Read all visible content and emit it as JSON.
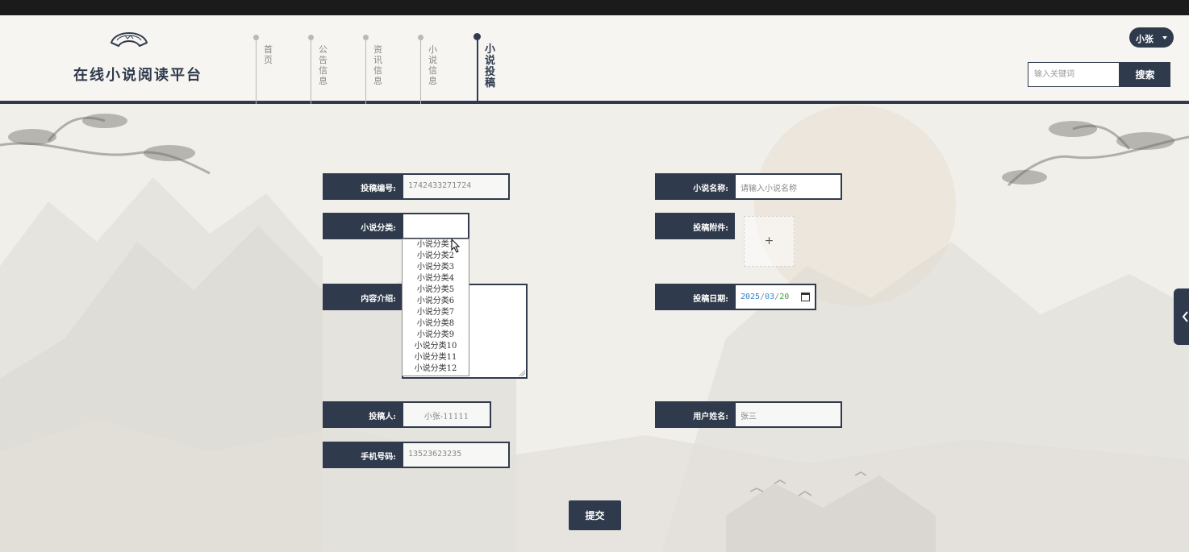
{
  "header": {
    "logo_text": "在线小说阅读平台",
    "nav": [
      {
        "label": "首页",
        "active": false
      },
      {
        "label": "公告信息",
        "active": false
      },
      {
        "label": "资讯信息",
        "active": false
      },
      {
        "label": "小说信息",
        "active": false
      },
      {
        "label": "小说投稿",
        "active": true
      }
    ],
    "user_label": "小张",
    "search_placeholder": "输入关键词",
    "search_button": "搜索"
  },
  "form": {
    "submission_no_label": "投稿编号:",
    "submission_no_value": "1742433271724",
    "novel_name_label": "小说名称:",
    "novel_name_placeholder": "请输入小说名称",
    "category_label": "小说分类:",
    "category_value": "",
    "attachment_label": "投稿附件:",
    "attachment_plus": "+",
    "intro_label": "内容介绍:",
    "date_label": "投稿日期:",
    "date_year": "2025",
    "date_sep": "/",
    "date_month": "03",
    "date_day": "20",
    "submitter_label": "投稿人:",
    "submitter_value": "小张-11111",
    "username_label": "用户姓名:",
    "username_value": "张三",
    "phone_label": "手机号码:",
    "phone_value": "13523623235",
    "submit_button": "提交"
  },
  "category_options": [
    "小说分类1",
    "小说分类2",
    "小说分类3",
    "小说分类4",
    "小说分类5",
    "小说分类6",
    "小说分类7",
    "小说分类8",
    "小说分类9",
    "小说分类10",
    "小说分类11",
    "小说分类12"
  ],
  "colors": {
    "accent": "#2f3b4d",
    "background": "#f1efea",
    "top_bar": "#1b1b1b"
  },
  "side_tab_icon": "chevron-left-icon"
}
